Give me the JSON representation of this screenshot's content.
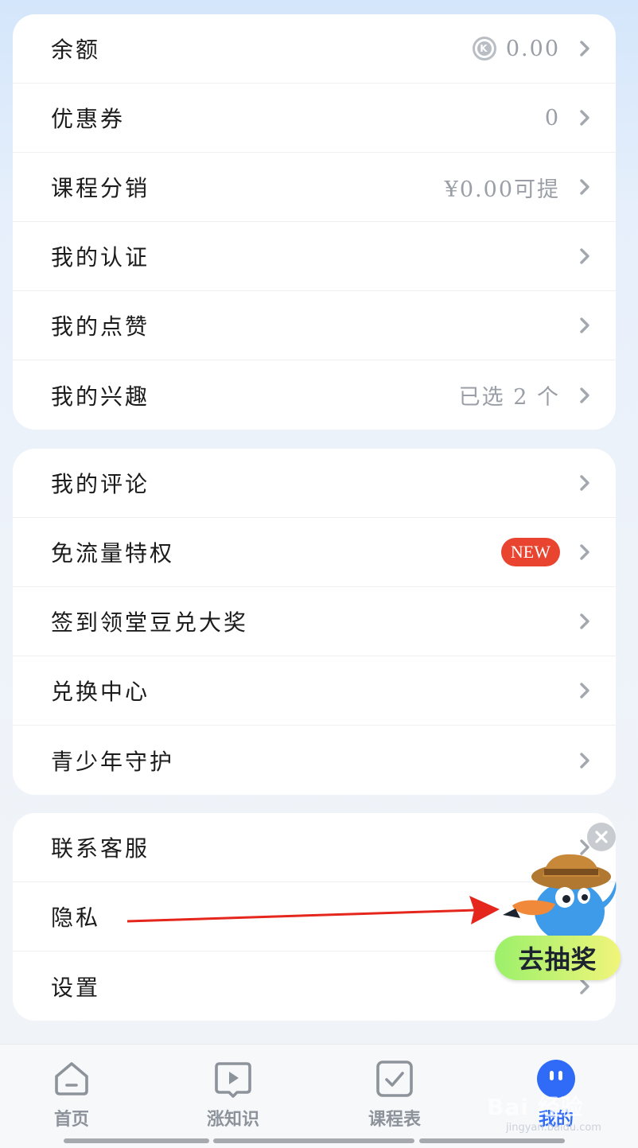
{
  "group1": {
    "balance": {
      "label": "余额",
      "value": "0.00",
      "coin_symbol": "K"
    },
    "coupons": {
      "label": "优惠券",
      "value": "0"
    },
    "distribution": {
      "label": "课程分销",
      "value": "¥0.00可提"
    },
    "certification": {
      "label": "我的认证"
    },
    "likes": {
      "label": "我的点赞"
    },
    "interests": {
      "label": "我的兴趣",
      "value": "已选 2 个"
    }
  },
  "group2": {
    "comments": {
      "label": "我的评论"
    },
    "free_data": {
      "label": "免流量特权",
      "badge": "NEW"
    },
    "checkin": {
      "label": "签到领堂豆兑大奖"
    },
    "exchange": {
      "label": "兑换中心"
    },
    "youth": {
      "label": "青少年守护"
    }
  },
  "group3": {
    "support": {
      "label": "联系客服"
    },
    "privacy": {
      "label": "隐私"
    },
    "settings": {
      "label": "设置"
    }
  },
  "float": {
    "lottery_label": "去抽奖"
  },
  "tabbar": {
    "home": "首页",
    "knowledge": "涨知识",
    "schedule": "课程表",
    "mine": "我的"
  },
  "watermark": {
    "text": "Bai 经验",
    "sub": "jingyan.baidu.com"
  },
  "colors": {
    "accent": "#2f6bf6",
    "badge": "#e8442f",
    "arrow": "#e5261c"
  },
  "icons": {
    "chevron": "chevron-right-icon",
    "close": "close-icon",
    "coin": "coin-icon"
  }
}
